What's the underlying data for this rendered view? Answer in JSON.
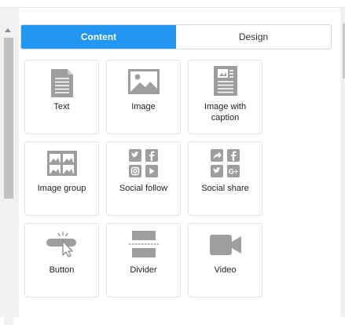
{
  "tabs": [
    {
      "label": "Content",
      "active": true
    },
    {
      "label": "Design",
      "active": false
    }
  ],
  "blocks": [
    {
      "label": "Text",
      "icon": "text-doc-icon"
    },
    {
      "label": "Image",
      "icon": "image-icon"
    },
    {
      "label": "Image with caption",
      "icon": "image-caption-icon"
    },
    {
      "label": "Image group",
      "icon": "image-group-icon"
    },
    {
      "label": "Social follow",
      "icon": "social-follow-icon"
    },
    {
      "label": "Social share",
      "icon": "social-share-icon"
    },
    {
      "label": "Button",
      "icon": "button-click-icon"
    },
    {
      "label": "Divider",
      "icon": "divider-icon"
    },
    {
      "label": "Video",
      "icon": "video-camera-icon"
    }
  ],
  "colors": {
    "accent": "#2196f3",
    "icon_gray": "#9e9e9e"
  }
}
